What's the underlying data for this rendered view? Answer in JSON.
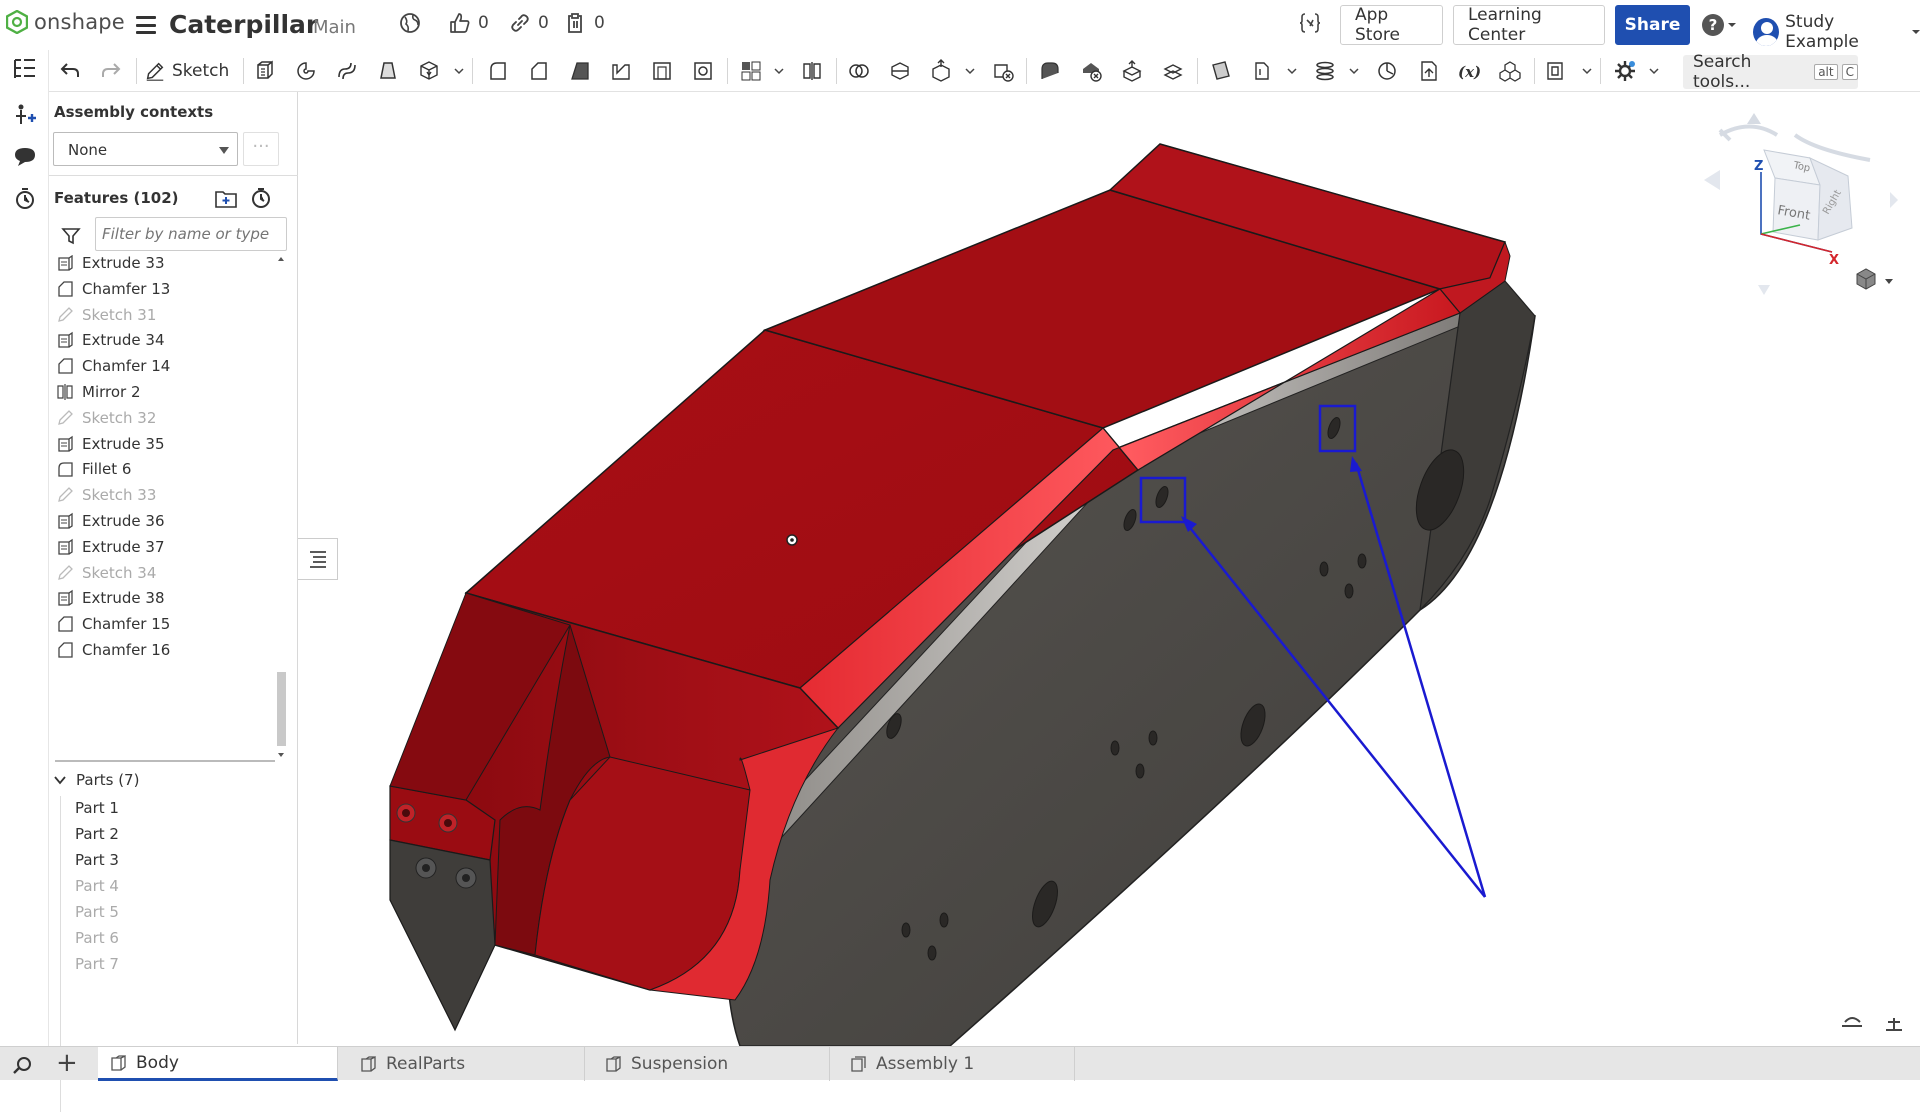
{
  "app": {
    "brand": "onshape"
  },
  "document": {
    "title": "Caterpillar",
    "branch": "Main"
  },
  "top_counts": {
    "likes": "0",
    "links": "0",
    "copies": "0"
  },
  "top_buttons": {
    "app_store": "App Store",
    "learning_center": "Learning Center",
    "share": "Share"
  },
  "user": {
    "name": "Study Example"
  },
  "toolbar": {
    "sketch_label": "Sketch",
    "search_placeholder": "Search tools...",
    "search_shortcut_1": "alt",
    "search_shortcut_2": "C"
  },
  "panel": {
    "assembly_contexts_label": "Assembly contexts",
    "assembly_context_value": "None",
    "more_label": "···",
    "features_label": "Features (102)",
    "filter_placeholder": "Filter by name or type",
    "features": [
      {
        "label": "Extrude 33",
        "kind": "extrude"
      },
      {
        "label": "Chamfer 13",
        "kind": "chamfer"
      },
      {
        "label": "Sketch 31",
        "kind": "sketch"
      },
      {
        "label": "Extrude 34",
        "kind": "extrude"
      },
      {
        "label": "Chamfer 14",
        "kind": "chamfer"
      },
      {
        "label": "Mirror 2",
        "kind": "mirror"
      },
      {
        "label": "Sketch 32",
        "kind": "sketch"
      },
      {
        "label": "Extrude 35",
        "kind": "extrude"
      },
      {
        "label": "Fillet 6",
        "kind": "fillet"
      },
      {
        "label": "Sketch 33",
        "kind": "sketch"
      },
      {
        "label": "Extrude 36",
        "kind": "extrude"
      },
      {
        "label": "Extrude 37",
        "kind": "extrude"
      },
      {
        "label": "Sketch 34",
        "kind": "sketch"
      },
      {
        "label": "Extrude 38",
        "kind": "extrude"
      },
      {
        "label": "Chamfer 15",
        "kind": "chamfer"
      },
      {
        "label": "Chamfer 16",
        "kind": "chamfer"
      }
    ],
    "parts_label": "Parts (7)",
    "parts": [
      {
        "label": "Part 1",
        "hidden": false
      },
      {
        "label": "Part 2",
        "hidden": false
      },
      {
        "label": "Part 3",
        "hidden": false
      },
      {
        "label": "Part 4",
        "hidden": true
      },
      {
        "label": "Part 5",
        "hidden": true
      },
      {
        "label": "Part 6",
        "hidden": true
      },
      {
        "label": "Part 7",
        "hidden": true
      }
    ]
  },
  "view_cube": {
    "top": "Top",
    "front": "Front",
    "right": "Right",
    "axis_z": "Z",
    "axis_x": "X"
  },
  "tabs": [
    {
      "label": "Body",
      "active": true
    },
    {
      "label": "RealParts",
      "active": false
    },
    {
      "label": "Suspension",
      "active": false
    },
    {
      "label": "Assembly 1",
      "active": false
    }
  ],
  "colors": {
    "accent": "#1f4fb0",
    "part_red": "#b5141b",
    "part_dark": "#4a4845",
    "annotation_blue": "#1a1ad0"
  }
}
